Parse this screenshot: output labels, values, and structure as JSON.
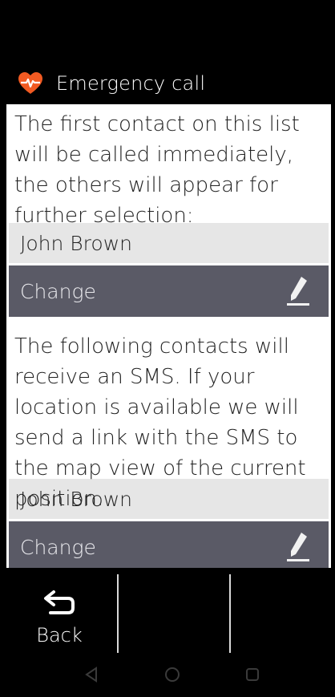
{
  "header": {
    "title": "Emergency call",
    "icon": "heart-pulse-icon",
    "icon_color": "#f15a22"
  },
  "section1": {
    "text": "The first contact on this list will be called immediately, the others will appear for further selection:",
    "contact": "John Brown",
    "change_label": "Change"
  },
  "section2": {
    "text": "The following contacts will receive an SMS. If your location is available we will send a link with the SMS to the map view of the current position.",
    "contact": "John Brown",
    "change_label": "Change"
  },
  "bottom_bar": {
    "back_label": "Back",
    "back_icon": "back-arrow-icon"
  },
  "nav": {
    "icons": [
      "nav-back-icon",
      "nav-home-icon",
      "nav-recents-icon"
    ]
  },
  "colors": {
    "change_bg": "#5a5a66",
    "contact_bg": "#e6e6e6"
  }
}
